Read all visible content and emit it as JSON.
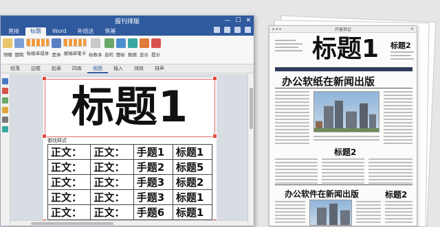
{
  "word": {
    "window_title": "报刊排版",
    "tabs": [
      "直接",
      "标题",
      "Word",
      "补结达",
      "筑基"
    ],
    "active_tab_index": 1,
    "ribbon": [
      "领赠",
      "题制",
      "标极单成体",
      "黑体",
      "展端单笔卡",
      "标数本",
      "自的",
      "图标",
      "数据",
      "显示",
      "提示"
    ],
    "subtabs": [
      "段落",
      "边框",
      "起表",
      "四库",
      "视图",
      "插入",
      "排效",
      "排声"
    ],
    "active_subtab_index": 4,
    "doc_title": "标题1",
    "style_label": "御伐释式",
    "table_rows": [
      [
        "正文：",
        "正文：",
        "手题1",
        "标题1"
      ],
      [
        "正文：",
        "正文：",
        "手题2",
        "标题5"
      ],
      [
        "正文：",
        "正文：",
        "手题3",
        "标题2"
      ],
      [
        "正文：",
        "正文：",
        "手题3",
        "标题1"
      ],
      [
        "正文：",
        "正文：",
        "手题6",
        "标题1"
      ]
    ]
  },
  "newspaper": {
    "window_title": "开着倒证",
    "masthead": "标题1",
    "masthead_side": "标题2",
    "headline": "办公软纸在新闻出版",
    "subheadline": "标题2",
    "headline_lower": "办公软件在新闻出版",
    "lower_side": "标题2"
  },
  "colors": {
    "word_blue": "#2f5a9e",
    "selection_red": "#e24a3b",
    "banner": "#2e3c5c"
  }
}
